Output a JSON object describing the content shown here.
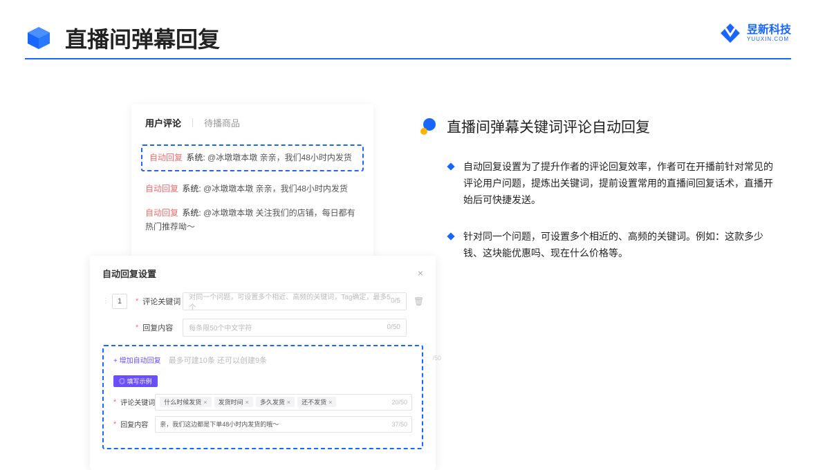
{
  "header": {
    "title": "直播间弹幕回复"
  },
  "brand": {
    "name": "昱新科技",
    "sub": "YUUXIN.COM"
  },
  "comments": {
    "tabs": {
      "active": "用户评论",
      "inactive": "待播商品"
    },
    "highlighted": {
      "badge": "自动回复",
      "sys": "系统:",
      "text": "@冰墩墩本墩 亲亲，我们48小时内发货"
    },
    "r2": {
      "badge": "自动回复",
      "sys": "系统:",
      "text": "@冰墩墩本墩 亲亲，我们48小时内发货"
    },
    "r3": {
      "badge": "自动回复",
      "sys": "系统:",
      "text": "@冰墩墩本墩 关注我们的店铺，每日都有热门推荐呦～"
    }
  },
  "settings": {
    "title": "自动回复设置",
    "num": "1",
    "row1": {
      "label": "评论关键词",
      "placeholder": "对同一个问题，可设置多个相近、高频的关键词，Tag确定，最多5个",
      "count": "0/5"
    },
    "row2": {
      "label": "回复内容",
      "placeholder": "每条限50个中文字符",
      "count": "0/50"
    },
    "addLink": "+ 增加自动回复",
    "addSub": "最多可建10条 还可以创建9条",
    "exampleBadge": "◎ 填写示例",
    "ex1": {
      "label": "评论关键词",
      "tags": [
        "什么时候发货",
        "发货时间",
        "多久发货",
        "还不发货"
      ],
      "count": "20/50"
    },
    "ex2": {
      "label": "回复内容",
      "val": "亲，我们这边都是下单48小时内发货的哦～",
      "count": "37/50"
    },
    "ghostCount": "/50"
  },
  "right": {
    "heading": "直播间弹幕关键词评论自动回复",
    "b1": "自动回复设置为了提升作者的评论回复效率，作者可在开播前针对常见的评论用户问题，提炼出关键词，提前设置常用的直播间回复话术，直播开始后可快捷发送。",
    "b2": "针对同一个问题，可设置多个相近的、高频的关键词。例如：这款多少钱、这块能优惠吗、现在什么价格等。"
  }
}
